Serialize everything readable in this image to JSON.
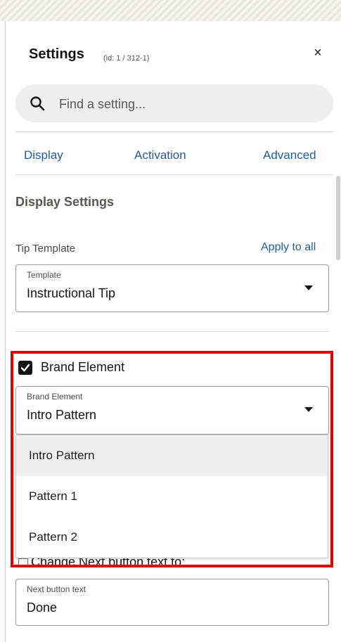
{
  "panel": {
    "title": "Settings",
    "id_text": "(id: 1 / 312-1)",
    "close_glyph": "×"
  },
  "search": {
    "placeholder": "Find a setting...",
    "icon": "search-icon"
  },
  "tabs": [
    {
      "label": "Display"
    },
    {
      "label": "Activation"
    },
    {
      "label": "Advanced"
    }
  ],
  "display_settings": {
    "heading": "Display Settings",
    "tip_template_label": "Tip Template",
    "apply_to_all": "Apply to all",
    "template_select": {
      "label": "Template",
      "value": "Instructional Tip"
    },
    "brand_element_checkbox": {
      "label": "Brand Element",
      "checked": true
    },
    "brand_element_select": {
      "label": "Brand Element",
      "value": "Intro Pattern",
      "options": [
        "Intro Pattern",
        "Pattern 1",
        "Pattern 2"
      ]
    },
    "change_next_text": "Change Next button text to:",
    "next_button_text_field": {
      "label": "Next button text",
      "value": "Done"
    }
  },
  "colors": {
    "link": "#1f5d9c",
    "highlight": "#e10000",
    "search_bg": "#f0eeec"
  }
}
